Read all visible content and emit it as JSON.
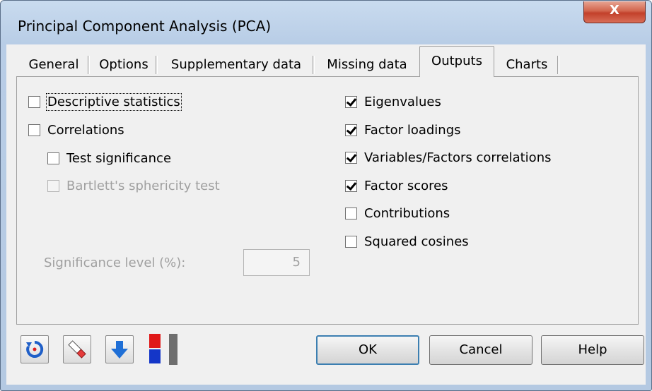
{
  "window": {
    "title": "Principal Component Analysis (PCA)",
    "close_label": "X"
  },
  "tabs": [
    {
      "label": "General"
    },
    {
      "label": "Options"
    },
    {
      "label": "Supplementary data"
    },
    {
      "label": "Missing data"
    },
    {
      "label": "Outputs",
      "active": true
    },
    {
      "label": "Charts"
    }
  ],
  "outputs": {
    "left": {
      "descriptive_statistics": {
        "label": "Descriptive statistics",
        "checked": false
      },
      "correlations": {
        "label": "Correlations",
        "checked": false
      },
      "test_significance": {
        "label": "Test significance",
        "checked": false
      },
      "bartlett": {
        "label": "Bartlett's sphericity test",
        "checked": false,
        "disabled": true
      },
      "significance_level": {
        "label": "Significance level (%):",
        "value": "5"
      }
    },
    "right": {
      "eigenvalues": {
        "label": "Eigenvalues",
        "checked": true
      },
      "factor_loadings": {
        "label": "Factor loadings",
        "checked": true
      },
      "var_factor_corr": {
        "label": "Variables/Factors correlations",
        "checked": true
      },
      "factor_scores": {
        "label": "Factor scores",
        "checked": true
      },
      "contributions": {
        "label": "Contributions",
        "checked": false
      },
      "squared_cosines": {
        "label": "Squared cosines",
        "checked": false
      }
    }
  },
  "toolbar_icons": [
    "reset-icon",
    "eraser-icon",
    "arrow-down-icon",
    "split-colors-icon"
  ],
  "buttons": {
    "ok": "OK",
    "cancel": "Cancel",
    "help": "Help"
  },
  "colors": {
    "accent_blue": "#1f5fc8",
    "title_bg": "#b9cde5",
    "close_red": "#c9452f"
  }
}
